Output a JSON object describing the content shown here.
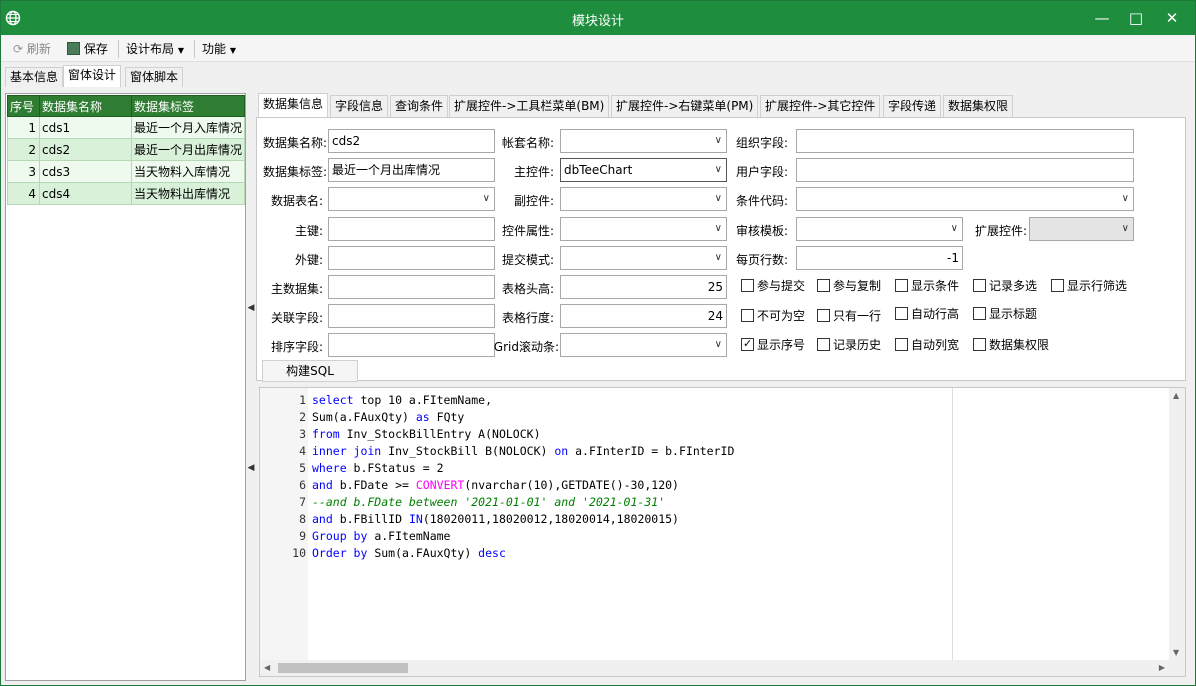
{
  "window": {
    "title": "模块设计",
    "app_icon": "globe-icon",
    "controls": [
      "minimize-icon",
      "maximize-icon",
      "close-icon"
    ]
  },
  "toolbar": {
    "refresh": "刷新",
    "save": "保存",
    "layout": "设计布局",
    "func": "功能"
  },
  "outer_tabs": [
    "基本信息",
    "窗体设计",
    "窗体脚本"
  ],
  "grid": {
    "headers": [
      "序号",
      "数据集名称",
      "数据集标签"
    ],
    "rows": [
      {
        "no": "1",
        "name": "cds1",
        "label": "最近一个月入库情况"
      },
      {
        "no": "2",
        "name": "cds2",
        "label": "最近一个月出库情况"
      },
      {
        "no": "3",
        "name": "cds3",
        "label": "当天物料入库情况"
      },
      {
        "no": "4",
        "name": "cds4",
        "label": "当天物料出库情况"
      }
    ]
  },
  "inner_tabs": [
    "数据集信息",
    "字段信息",
    "查询条件",
    "扩展控件->工具栏菜单(BM)",
    "扩展控件->右键菜单(PM)",
    "扩展控件->其它控件",
    "字段传递",
    "数据集权限"
  ],
  "form": {
    "dataset_name_label": "数据集名称:",
    "dataset_name": "cds2",
    "dataset_tag_label": "数据集标签:",
    "dataset_tag": "最近一个月出库情况",
    "table_name_label": "数据表名:",
    "pk_label": "主键:",
    "fk_label": "外键:",
    "master_label": "主数据集:",
    "rel_label": "关联字段:",
    "sort_label": "排序字段:",
    "account_label": "帐套名称:",
    "main_ctrl_label": "主控件:",
    "main_ctrl": "dbTeeChart",
    "sub_ctrl_label": "副控件:",
    "ctrl_prop_label": "控件属性:",
    "submit_label": "提交模式:",
    "header_h_label": "表格头高:",
    "header_h": "25",
    "row_h_label": "表格行度:",
    "row_h": "24",
    "scroll_label": "Grid滚动条:",
    "org_label": "组织字段:",
    "user_label": "用户字段:",
    "cond_label": "条件代码:",
    "audit_label": "审核模板:",
    "ext_label": "扩展控件:",
    "page_label": "每页行数:",
    "page_rows": "-1",
    "build_sql": "构建SQL"
  },
  "checkboxes": [
    {
      "label": "参与提交",
      "checked": false
    },
    {
      "label": "参与复制",
      "checked": false
    },
    {
      "label": "显示条件",
      "checked": false
    },
    {
      "label": "记录多选",
      "checked": false
    },
    {
      "label": "显示行筛选",
      "checked": false
    },
    {
      "label": "不可为空",
      "checked": false
    },
    {
      "label": "只有一行",
      "checked": false
    },
    {
      "label": "自动行高",
      "checked": false
    },
    {
      "label": "显示标题",
      "checked": false
    },
    {
      "label": "显示序号",
      "checked": true
    },
    {
      "label": "记录历史",
      "checked": false
    },
    {
      "label": "自动列宽",
      "checked": false
    },
    {
      "label": "数据集权限",
      "checked": false
    }
  ],
  "sql_lines": [
    "select top 10 a.FItemName,",
    "Sum(a.FAuxQty) as FQty",
    "from Inv_StockBillEntry A(NOLOCK)",
    "inner join Inv_StockBill B(NOLOCK) on a.FInterID = b.FInterID",
    "where b.FStatus = 2",
    "and b.FDate >= CONVERT(nvarchar(10),GETDATE()-30,120)",
    "--and b.FDate between '2021-01-01' and '2021-01-31'",
    "and b.FBillID IN(18020011,18020012,18020014,18020015)",
    "Group by a.FItemName",
    "Order by Sum(a.FAuxQty) desc"
  ],
  "colors": {
    "title_bar": "#1e8e3e",
    "grid_header": "#2e7d32",
    "row_even": "#d9f0d9",
    "row_odd": "#eefaee",
    "keyword": "#0000ff",
    "function": "#ff00ff",
    "comment": "#008000"
  }
}
